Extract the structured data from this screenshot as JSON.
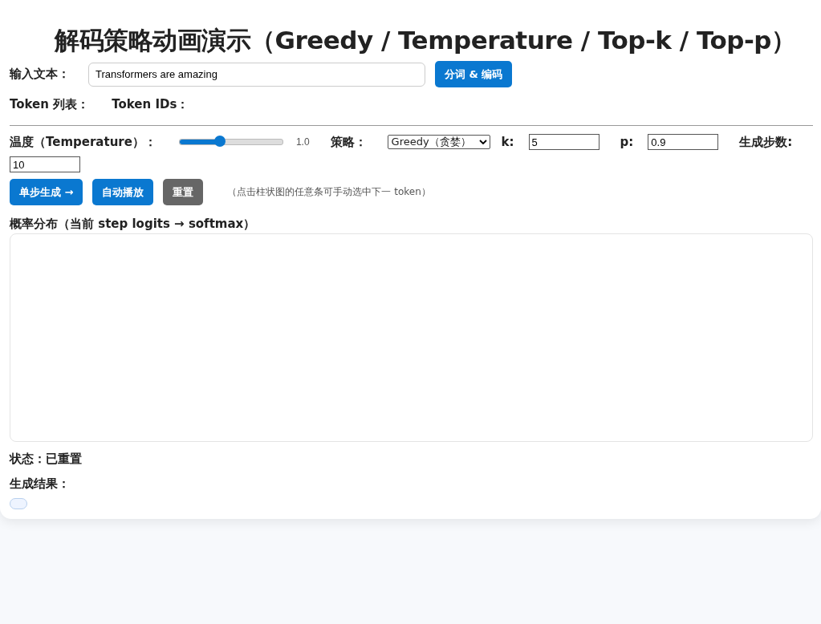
{
  "title": "解码策略动画演示（Greedy / Temperature / Top-k / Top-p）",
  "input": {
    "label": "输入文本：",
    "value": "Transformers are amazing",
    "button": "分词 & 编码"
  },
  "token_list": {
    "label": "Token 列表："
  },
  "token_ids": {
    "label": "Token IDs："
  },
  "temperature": {
    "label": "温度（Temperature）：",
    "level": 0.39,
    "reading": "1.0"
  },
  "strategy": {
    "label": "策略：",
    "value": "Greedy（贪婪）"
  },
  "k": {
    "label": "k:",
    "value": "5"
  },
  "p": {
    "label": "p:",
    "value": "0.9"
  },
  "steps": {
    "label": "生成步数:",
    "value": "10"
  },
  "buttons": [
    {
      "label": "单步生成 →",
      "kind": "primary"
    },
    {
      "label": "自动播放",
      "kind": "primary"
    },
    {
      "label": "重置",
      "kind": "secondary"
    }
  ],
  "hint": "（点击柱状图的任意条可手动选中下一 token）",
  "chart_title": "概率分布（当前 step logits → softmax）",
  "status": "状态：已重置",
  "result_label": "生成结果："
}
